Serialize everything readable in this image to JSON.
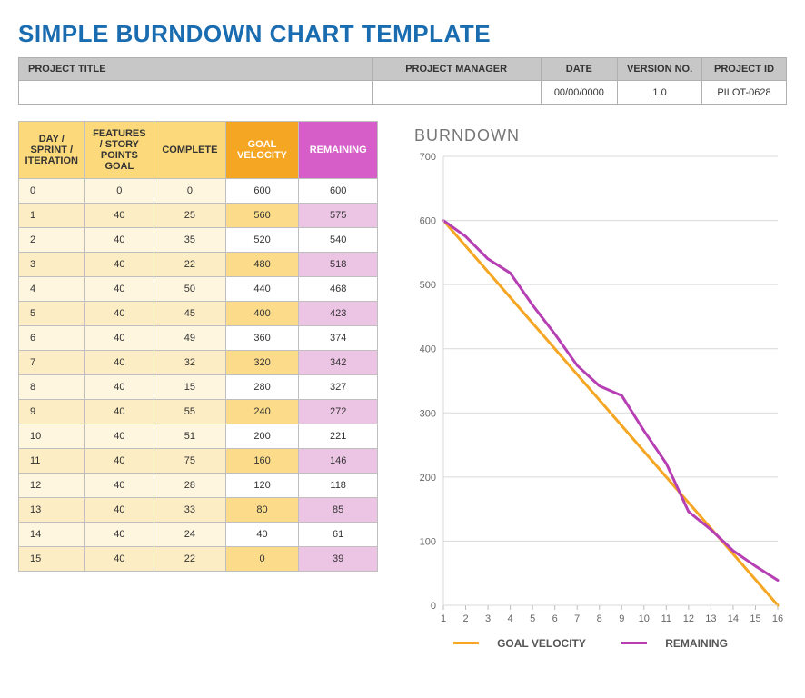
{
  "title": "SIMPLE BURNDOWN CHART TEMPLATE",
  "info": {
    "headers": {
      "project_title": "PROJECT TITLE",
      "project_manager": "PROJECT MANAGER",
      "date": "DATE",
      "version": "VERSION NO.",
      "project_id": "PROJECT ID"
    },
    "values": {
      "project_title": "",
      "project_manager": "",
      "date": "00/00/0000",
      "version": "1.0",
      "project_id": "PILOT-0628"
    }
  },
  "table": {
    "headers": {
      "day": "DAY / SPRINT / ITERATION",
      "features": "FEATURES / STORY POINTS GOAL",
      "complete": "COMPLETE",
      "goal_velocity": "GOAL VELOCITY",
      "remaining": "REMAINING"
    },
    "rows": [
      {
        "day": "0",
        "features": "0",
        "complete": "0",
        "goal": "600",
        "remaining": "600"
      },
      {
        "day": "1",
        "features": "40",
        "complete": "25",
        "goal": "560",
        "remaining": "575"
      },
      {
        "day": "2",
        "features": "40",
        "complete": "35",
        "goal": "520",
        "remaining": "540"
      },
      {
        "day": "3",
        "features": "40",
        "complete": "22",
        "goal": "480",
        "remaining": "518"
      },
      {
        "day": "4",
        "features": "40",
        "complete": "50",
        "goal": "440",
        "remaining": "468"
      },
      {
        "day": "5",
        "features": "40",
        "complete": "45",
        "goal": "400",
        "remaining": "423"
      },
      {
        "day": "6",
        "features": "40",
        "complete": "49",
        "goal": "360",
        "remaining": "374"
      },
      {
        "day": "7",
        "features": "40",
        "complete": "32",
        "goal": "320",
        "remaining": "342"
      },
      {
        "day": "8",
        "features": "40",
        "complete": "15",
        "goal": "280",
        "remaining": "327"
      },
      {
        "day": "9",
        "features": "40",
        "complete": "55",
        "goal": "240",
        "remaining": "272"
      },
      {
        "day": "10",
        "features": "40",
        "complete": "51",
        "goal": "200",
        "remaining": "221"
      },
      {
        "day": "11",
        "features": "40",
        "complete": "75",
        "goal": "160",
        "remaining": "146"
      },
      {
        "day": "12",
        "features": "40",
        "complete": "28",
        "goal": "120",
        "remaining": "118"
      },
      {
        "day": "13",
        "features": "40",
        "complete": "33",
        "goal": "80",
        "remaining": "85"
      },
      {
        "day": "14",
        "features": "40",
        "complete": "24",
        "goal": "40",
        "remaining": "61"
      },
      {
        "day": "15",
        "features": "40",
        "complete": "22",
        "goal": "0",
        "remaining": "39"
      }
    ]
  },
  "chart_title": "BURNDOWN",
  "legend": {
    "goal": "GOAL VELOCITY",
    "remaining": "REMAINING"
  },
  "chart_data": {
    "type": "line",
    "title": "BURNDOWN",
    "xlabel": "",
    "ylabel": "",
    "x_ticks": [
      1,
      2,
      3,
      4,
      5,
      6,
      7,
      8,
      9,
      10,
      11,
      12,
      13,
      14,
      15,
      16
    ],
    "y_ticks": [
      0,
      100,
      200,
      300,
      400,
      500,
      600,
      700
    ],
    "ylim": [
      0,
      700
    ],
    "x": [
      1,
      2,
      3,
      4,
      5,
      6,
      7,
      8,
      9,
      10,
      11,
      12,
      13,
      14,
      15,
      16
    ],
    "series": [
      {
        "name": "GOAL VELOCITY",
        "color": "#f5a623",
        "values": [
          600,
          560,
          520,
          480,
          440,
          400,
          360,
          320,
          280,
          240,
          200,
          160,
          120,
          80,
          40,
          0
        ]
      },
      {
        "name": "REMAINING",
        "color": "#b63fb3",
        "values": [
          600,
          575,
          540,
          518,
          468,
          423,
          374,
          342,
          327,
          272,
          221,
          146,
          118,
          85,
          61,
          39
        ]
      }
    ]
  }
}
